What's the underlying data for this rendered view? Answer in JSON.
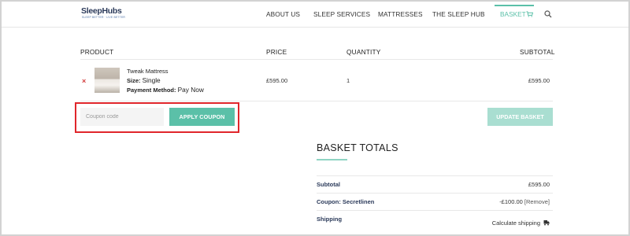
{
  "header": {
    "logo_text": "SleepHubs",
    "logo_tagline": "SLEEP BETTER · LIVE BETTER",
    "nav": [
      {
        "label": "ABOUT US"
      },
      {
        "label": "SLEEP SERVICES"
      },
      {
        "label": "MATTRESSES"
      },
      {
        "label": "THE SLEEP HUB"
      }
    ],
    "basket_label": "BASKET",
    "icons": {
      "cart": "cart-icon",
      "search": "search-icon"
    },
    "accent_color": "#5bc0a8"
  },
  "cart_table": {
    "headers": {
      "product": "PRODUCT",
      "price": "PRICE",
      "quantity": "QUANTITY",
      "subtotal": "SUBTOTAL"
    },
    "items": [
      {
        "remove_glyph": "×",
        "name": "Tweak Mattress",
        "size_label": "Size:",
        "size_value": "Single",
        "payment_label": "Payment Method:",
        "payment_value": "Pay Now",
        "price": "£595.00",
        "quantity": "1",
        "subtotal": "£595.00"
      }
    ]
  },
  "coupon": {
    "placeholder": "Coupon code",
    "apply_label": "APPLY COUPON",
    "highlight_color": "#e0262b"
  },
  "update_label": "UPDATE BASKET",
  "totals": {
    "title": "BASKET TOTALS",
    "rows": [
      {
        "label": "Subtotal",
        "value": "£595.00"
      },
      {
        "label": "Coupon: Secretlinen",
        "value": "-£100.00",
        "action": "[Remove]"
      },
      {
        "label": "Shipping",
        "value": "Calculate shipping"
      }
    ]
  }
}
